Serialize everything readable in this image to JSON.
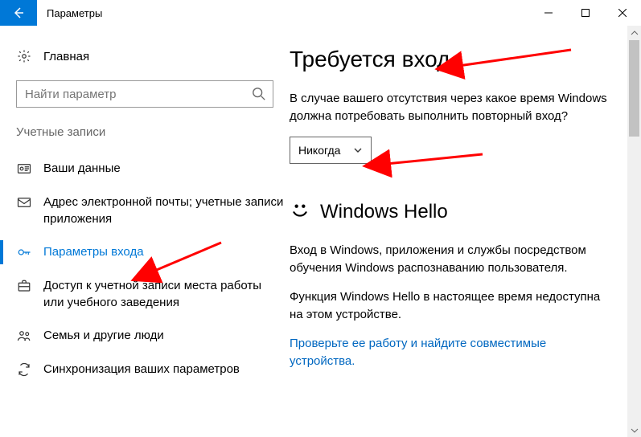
{
  "window": {
    "title": "Параметры"
  },
  "sidebar": {
    "home_label": "Главная",
    "search_placeholder": "Найти параметр",
    "category_label": "Учетные записи",
    "items": [
      {
        "label": "Ваши данные"
      },
      {
        "label": "Адрес электронной почты; учетные записи приложения"
      },
      {
        "label": "Параметры входа"
      },
      {
        "label": "Доступ к учетной записи места работы или учебного заведения"
      },
      {
        "label": "Семья и другие люди"
      },
      {
        "label": "Синхронизация ваших параметров"
      }
    ]
  },
  "content": {
    "require_signin_heading": "Требуется вход",
    "require_signin_body": "В случае вашего отсутствия через какое время Windows должна потребовать выполнить повторный вход?",
    "require_signin_value": "Никогда",
    "hello_heading": "Windows Hello",
    "hello_body1": "Вход в Windows, приложения и службы посредством обучения Windows распознаванию пользователя.",
    "hello_body2": "Функция Windows Hello в настоящее время недоступна на этом устройстве.",
    "hello_link": "Проверьте ее работу и найдите совместимые устройства."
  }
}
